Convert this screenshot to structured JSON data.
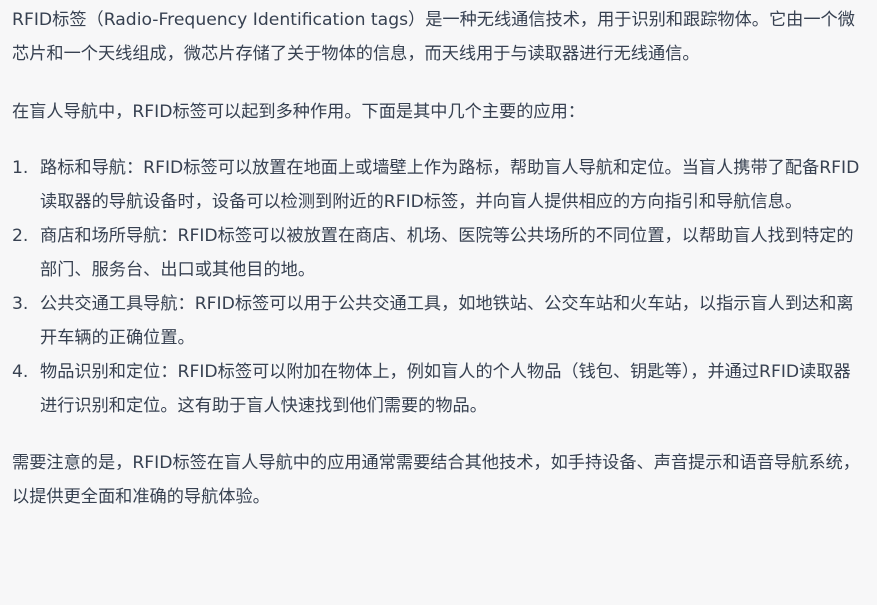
{
  "paragraphs": {
    "intro": "RFID标签（Radio-Frequency Identification tags）是一种无线通信技术，用于识别和跟踪物体。它由一个微芯片和一个天线组成，微芯片存储了关于物体的信息，而天线用于与读取器进行无线通信。",
    "lead": "在盲人导航中，RFID标签可以起到多种作用。下面是其中几个主要的应用：",
    "note": "需要注意的是，RFID标签在盲人导航中的应用通常需要结合其他技术，如手持设备、声音提示和语音导航系统，以提供更全面和准确的导航体验。"
  },
  "list": [
    {
      "num": "1.",
      "text": "路标和导航：RFID标签可以放置在地面上或墙壁上作为路标，帮助盲人导航和定位。当盲人携带了配备RFID读取器的导航设备时，设备可以检测到附近的RFID标签，并向盲人提供相应的方向指引和导航信息。"
    },
    {
      "num": "2.",
      "text": "商店和场所导航：RFID标签可以被放置在商店、机场、医院等公共场所的不同位置，以帮助盲人找到特定的部门、服务台、出口或其他目的地。"
    },
    {
      "num": "3.",
      "text": "公共交通工具导航：RFID标签可以用于公共交通工具，如地铁站、公交车站和火车站，以指示盲人到达和离开车辆的正确位置。"
    },
    {
      "num": "4.",
      "text": "物品识别和定位：RFID标签可以附加在物体上，例如盲人的个人物品（钱包、钥匙等），并通过RFID读取器进行识别和定位。这有助于盲人快速找到他们需要的物品。"
    }
  ],
  "colors": {
    "text": "#374151",
    "background": "#f7f7f8"
  }
}
